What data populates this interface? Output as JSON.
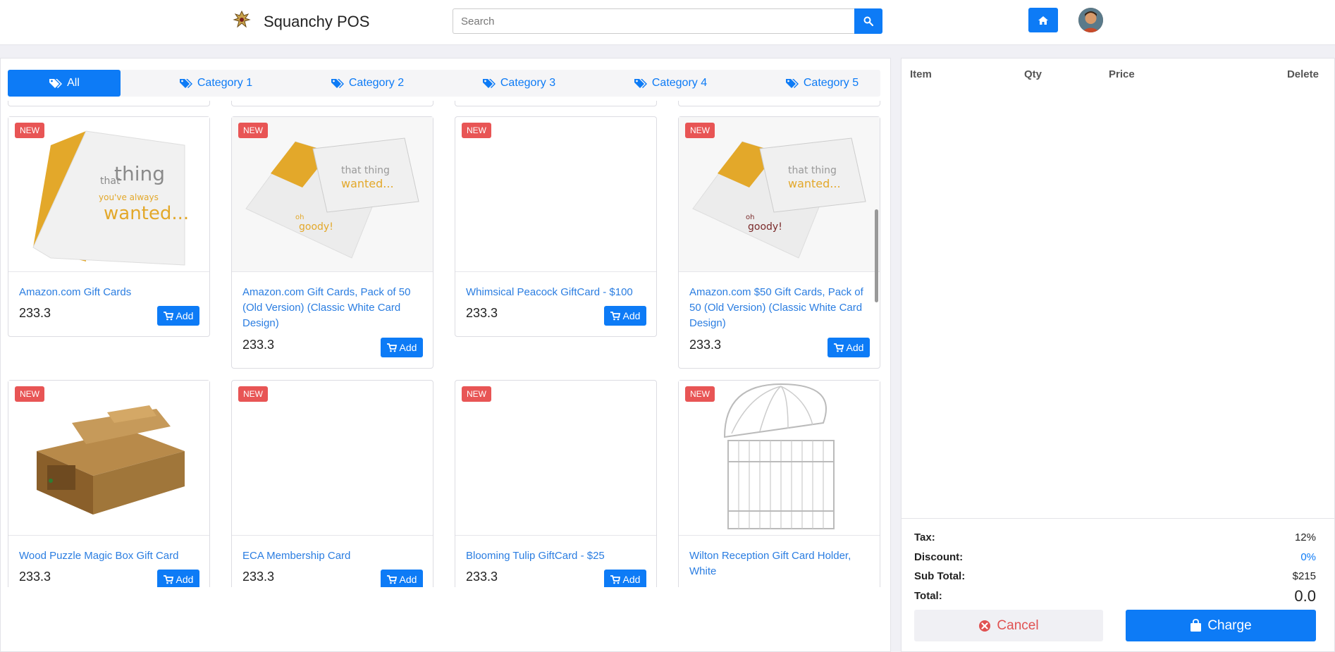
{
  "header": {
    "brand": "Squanchy POS",
    "search_placeholder": "Search"
  },
  "tabs": [
    {
      "label": "All",
      "active": true
    },
    {
      "label": "Category 1"
    },
    {
      "label": "Category 2"
    },
    {
      "label": "Category 3"
    },
    {
      "label": "Category 4"
    },
    {
      "label": "Category 5"
    }
  ],
  "products": [
    {
      "badge": "NEW",
      "title": "Amazon.com Gift Cards",
      "price": "233.3",
      "add_label": "Add",
      "image": "gift-card-folded-icon"
    },
    {
      "badge": "NEW",
      "title": "Amazon.com Gift Cards, Pack of 50 (Old Version) (Classic White Card Design)",
      "price": "233.3",
      "add_label": "Add",
      "image": "gift-card-envelope-icon"
    },
    {
      "badge": "NEW",
      "title": "Whimsical Peacock GiftCard - $100",
      "price": "233.3",
      "add_label": "Add",
      "image": ""
    },
    {
      "badge": "NEW",
      "title": "Amazon.com $50 Gift Cards, Pack of 50 (Old Version) (Classic White Card Design)",
      "price": "233.3",
      "add_label": "Add",
      "image": "gift-card-envelope-icon"
    },
    {
      "badge": "NEW",
      "title": "Wood Puzzle Magic Box Gift Card",
      "price": "233.3",
      "add_label": "Add",
      "image": "wooden-box-icon"
    },
    {
      "badge": "NEW",
      "title": "ECA Membership Card",
      "price": "233.3",
      "add_label": "Add",
      "image": ""
    },
    {
      "badge": "NEW",
      "title": "Blooming Tulip GiftCard - $25",
      "price": "233.3",
      "add_label": "Add",
      "image": ""
    },
    {
      "badge": "NEW",
      "title": "Wilton Reception Gift Card Holder, White",
      "price": "",
      "add_label": "",
      "image": "birdcage-icon"
    }
  ],
  "cart": {
    "columns": [
      "Item",
      "Qty",
      "Price",
      "Delete"
    ],
    "tax_label": "Tax:",
    "tax": "12%",
    "discount_label": "Discount:",
    "discount": "0%",
    "subtotal_label": "Sub Total:",
    "subtotal": "$215",
    "total_label": "Total:",
    "total": "0.0",
    "cancel_label": "Cancel",
    "charge_label": "Charge"
  },
  "colors": {
    "accent": "#0d7bf6",
    "badge": "#e85555",
    "cancel": "#e05252"
  }
}
